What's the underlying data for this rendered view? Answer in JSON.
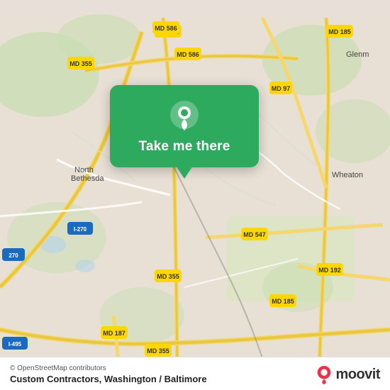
{
  "map": {
    "background_color": "#e8e0d8",
    "center_lat": 39.04,
    "center_lng": -77.08
  },
  "popup": {
    "label": "Take me there",
    "pin_icon": "location-pin"
  },
  "bottom_bar": {
    "osm_credit": "© OpenStreetMap contributors",
    "location_title": "Custom Contractors, Washington / Baltimore",
    "moovit_label": "moovit"
  }
}
